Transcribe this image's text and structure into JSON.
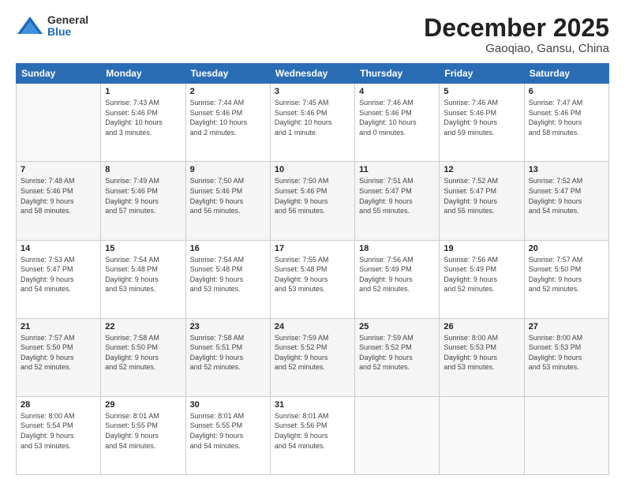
{
  "header": {
    "logo_general": "General",
    "logo_blue": "Blue",
    "month_title": "December 2025",
    "location": "Gaoqiao, Gansu, China"
  },
  "days_of_week": [
    "Sunday",
    "Monday",
    "Tuesday",
    "Wednesday",
    "Thursday",
    "Friday",
    "Saturday"
  ],
  "weeks": [
    [
      {
        "day": "",
        "info": ""
      },
      {
        "day": "1",
        "info": "Sunrise: 7:43 AM\nSunset: 5:46 PM\nDaylight: 10 hours\nand 3 minutes."
      },
      {
        "day": "2",
        "info": "Sunrise: 7:44 AM\nSunset: 5:46 PM\nDaylight: 10 hours\nand 2 minutes."
      },
      {
        "day": "3",
        "info": "Sunrise: 7:45 AM\nSunset: 5:46 PM\nDaylight: 10 hours\nand 1 minute."
      },
      {
        "day": "4",
        "info": "Sunrise: 7:46 AM\nSunset: 5:46 PM\nDaylight: 10 hours\nand 0 minutes."
      },
      {
        "day": "5",
        "info": "Sunrise: 7:46 AM\nSunset: 5:46 PM\nDaylight: 9 hours\nand 59 minutes."
      },
      {
        "day": "6",
        "info": "Sunrise: 7:47 AM\nSunset: 5:46 PM\nDaylight: 9 hours\nand 58 minutes."
      }
    ],
    [
      {
        "day": "7",
        "info": "Sunrise: 7:48 AM\nSunset: 5:46 PM\nDaylight: 9 hours\nand 58 minutes."
      },
      {
        "day": "8",
        "info": "Sunrise: 7:49 AM\nSunset: 5:46 PM\nDaylight: 9 hours\nand 57 minutes."
      },
      {
        "day": "9",
        "info": "Sunrise: 7:50 AM\nSunset: 5:46 PM\nDaylight: 9 hours\nand 56 minutes."
      },
      {
        "day": "10",
        "info": "Sunrise: 7:50 AM\nSunset: 5:46 PM\nDaylight: 9 hours\nand 56 minutes."
      },
      {
        "day": "11",
        "info": "Sunrise: 7:51 AM\nSunset: 5:47 PM\nDaylight: 9 hours\nand 55 minutes."
      },
      {
        "day": "12",
        "info": "Sunrise: 7:52 AM\nSunset: 5:47 PM\nDaylight: 9 hours\nand 55 minutes."
      },
      {
        "day": "13",
        "info": "Sunrise: 7:52 AM\nSunset: 5:47 PM\nDaylight: 9 hours\nand 54 minutes."
      }
    ],
    [
      {
        "day": "14",
        "info": "Sunrise: 7:53 AM\nSunset: 5:47 PM\nDaylight: 9 hours\nand 54 minutes."
      },
      {
        "day": "15",
        "info": "Sunrise: 7:54 AM\nSunset: 5:48 PM\nDaylight: 9 hours\nand 53 minutes."
      },
      {
        "day": "16",
        "info": "Sunrise: 7:54 AM\nSunset: 5:48 PM\nDaylight: 9 hours\nand 53 minutes."
      },
      {
        "day": "17",
        "info": "Sunrise: 7:55 AM\nSunset: 5:48 PM\nDaylight: 9 hours\nand 53 minutes."
      },
      {
        "day": "18",
        "info": "Sunrise: 7:56 AM\nSunset: 5:49 PM\nDaylight: 9 hours\nand 52 minutes."
      },
      {
        "day": "19",
        "info": "Sunrise: 7:56 AM\nSunset: 5:49 PM\nDaylight: 9 hours\nand 52 minutes."
      },
      {
        "day": "20",
        "info": "Sunrise: 7:57 AM\nSunset: 5:50 PM\nDaylight: 9 hours\nand 52 minutes."
      }
    ],
    [
      {
        "day": "21",
        "info": "Sunrise: 7:57 AM\nSunset: 5:50 PM\nDaylight: 9 hours\nand 52 minutes."
      },
      {
        "day": "22",
        "info": "Sunrise: 7:58 AM\nSunset: 5:50 PM\nDaylight: 9 hours\nand 52 minutes."
      },
      {
        "day": "23",
        "info": "Sunrise: 7:58 AM\nSunset: 5:51 PM\nDaylight: 9 hours\nand 52 minutes."
      },
      {
        "day": "24",
        "info": "Sunrise: 7:59 AM\nSunset: 5:52 PM\nDaylight: 9 hours\nand 52 minutes."
      },
      {
        "day": "25",
        "info": "Sunrise: 7:59 AM\nSunset: 5:52 PM\nDaylight: 9 hours\nand 52 minutes."
      },
      {
        "day": "26",
        "info": "Sunrise: 8:00 AM\nSunset: 5:53 PM\nDaylight: 9 hours\nand 53 minutes."
      },
      {
        "day": "27",
        "info": "Sunrise: 8:00 AM\nSunset: 5:53 PM\nDaylight: 9 hours\nand 53 minutes."
      }
    ],
    [
      {
        "day": "28",
        "info": "Sunrise: 8:00 AM\nSunset: 5:54 PM\nDaylight: 9 hours\nand 53 minutes."
      },
      {
        "day": "29",
        "info": "Sunrise: 8:01 AM\nSunset: 5:55 PM\nDaylight: 9 hours\nand 54 minutes."
      },
      {
        "day": "30",
        "info": "Sunrise: 8:01 AM\nSunset: 5:55 PM\nDaylight: 9 hours\nand 54 minutes."
      },
      {
        "day": "31",
        "info": "Sunrise: 8:01 AM\nSunset: 5:56 PM\nDaylight: 9 hours\nand 54 minutes."
      },
      {
        "day": "",
        "info": ""
      },
      {
        "day": "",
        "info": ""
      },
      {
        "day": "",
        "info": ""
      }
    ]
  ]
}
